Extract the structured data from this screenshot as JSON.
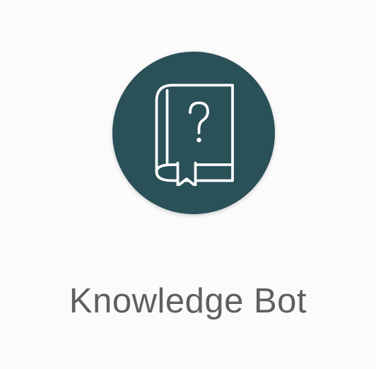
{
  "app": {
    "label": "Knowledge Bot",
    "icon": "book-question-icon"
  },
  "colors": {
    "icon_background": "#2a5058",
    "icon_stroke": "#ffffff",
    "label_text": "#5f5f5f",
    "page_background": "#fbfbfb"
  }
}
